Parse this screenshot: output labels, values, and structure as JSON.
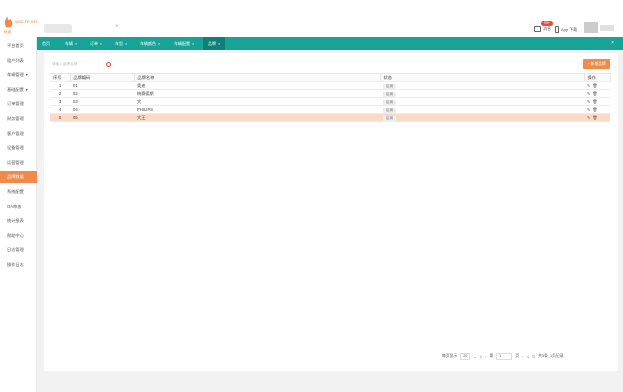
{
  "topbar": {
    "logo_text": "#85CFE 033",
    "logo_sub": "轨道",
    "top_glyph": "×",
    "messages_label": "消息",
    "messages_badge": "99+",
    "app_label": "App 下载"
  },
  "sidebar": {
    "items": [
      {
        "label": "平台首页",
        "caret": ""
      },
      {
        "label": "租户列表",
        "caret": ""
      },
      {
        "label": "车辆管理",
        "caret": "▾"
      },
      {
        "label": "基础配置",
        "caret": "▾"
      },
      {
        "label": "订单管理",
        "caret": ""
      },
      {
        "label": "财务管理",
        "caret": ""
      },
      {
        "label": "客户管理",
        "caret": ""
      },
      {
        "label": "设备管理",
        "caret": ""
      },
      {
        "label": "运营管理",
        "caret": ""
      },
      {
        "label": "品牌数据",
        "caret": ""
      },
      {
        "label": "系统配置",
        "caret": ""
      },
      {
        "label": "OA审核",
        "caret": ""
      },
      {
        "label": "统计报表",
        "caret": ""
      },
      {
        "label": "帮助中心",
        "caret": ""
      },
      {
        "label": "日志管理",
        "caret": ""
      },
      {
        "label": "操作日志",
        "caret": ""
      }
    ],
    "active_index": 9
  },
  "tabs": {
    "items": [
      {
        "label": "首页",
        "closable": false
      },
      {
        "label": "车辆",
        "closable": true
      },
      {
        "label": "订单",
        "closable": true
      },
      {
        "label": "车型",
        "closable": true
      },
      {
        "label": "车辆颜色",
        "closable": true
      },
      {
        "label": "车辆配置",
        "closable": true
      },
      {
        "label": "品牌",
        "closable": true
      }
    ],
    "active_index": 6,
    "close_all": "×"
  },
  "toolbar": {
    "search_placeholder": "请输入品牌名称",
    "add_button": "+ 新增品牌"
  },
  "table": {
    "columns": [
      "序号",
      "品牌编码",
      "品牌名称",
      "状态",
      "操作"
    ],
    "rows": [
      {
        "index": "1",
        "code": "01",
        "name": "奥迪",
        "status": "启用"
      },
      {
        "index": "2",
        "code": "02",
        "name": "梅赛德斯",
        "status": "启用"
      },
      {
        "index": "3",
        "code": "03",
        "name": "大",
        "status": "启用"
      },
      {
        "index": "4",
        "code": "04",
        "name": "PHILIPS",
        "status": "启用"
      },
      {
        "index": "5",
        "code": "05",
        "name": "大王",
        "status": "启用"
      }
    ],
    "selected_row": 4,
    "op_edit": "✎",
    "op_delete": "🗑"
  },
  "pager": {
    "page_size_label": "每页显示",
    "page_size": "20",
    "page_label": "第",
    "page_value": "1",
    "page_suffix": "页",
    "total": "共5条, 1页记录"
  }
}
